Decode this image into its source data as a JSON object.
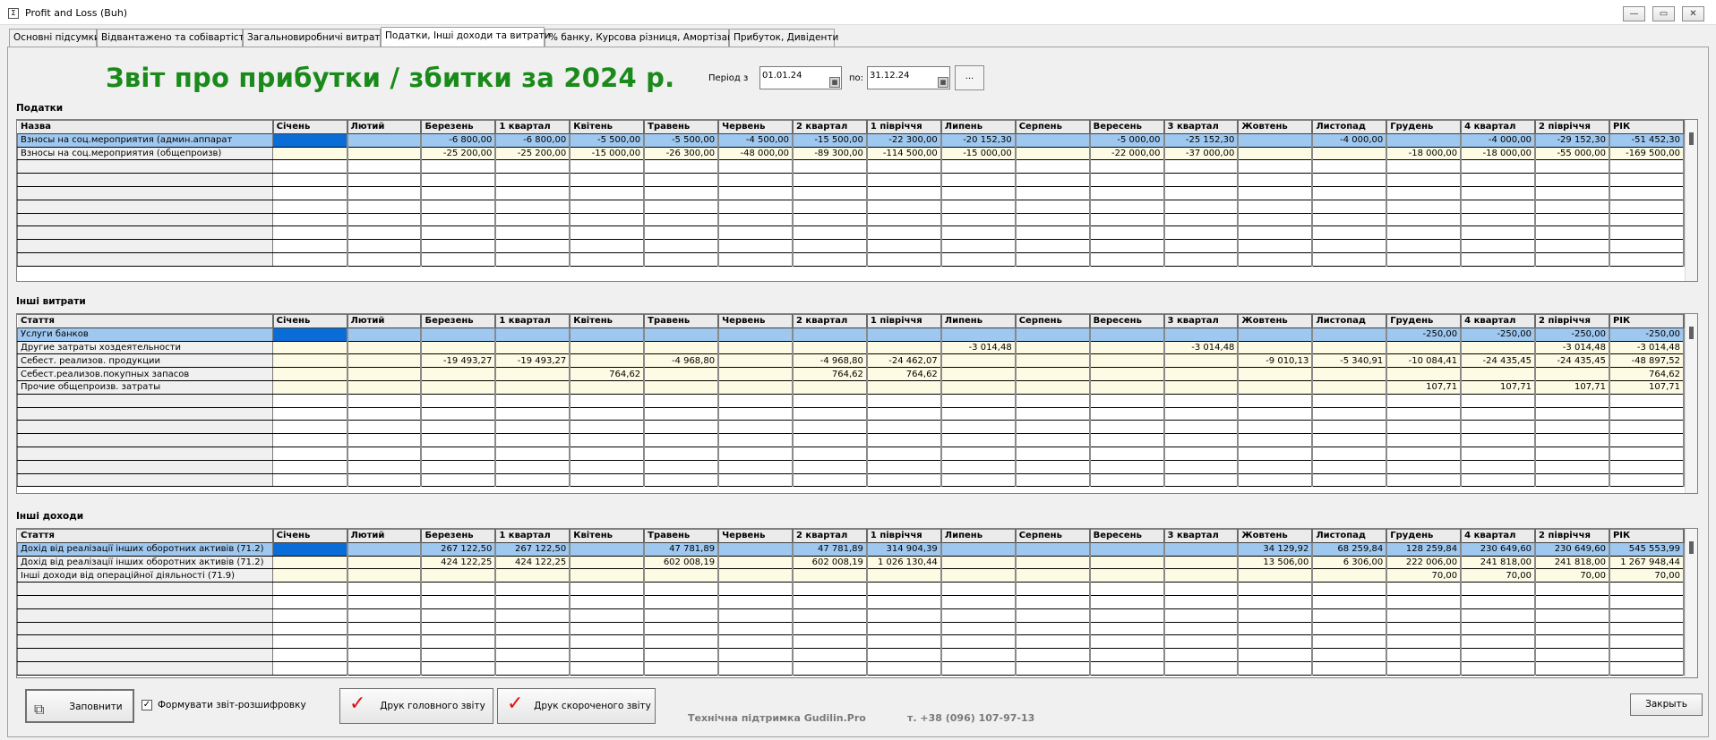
{
  "window": {
    "title": "Profit and Loss (Buh)",
    "app_icon": "calculator-icon",
    "controls": [
      "minimize-icon",
      "maximize-icon",
      "close-icon"
    ]
  },
  "tabs": [
    {
      "label": "Основні підсумки",
      "active": false
    },
    {
      "label": "Відвантажено та собівартість",
      "active": false
    },
    {
      "label": "Загальновиробничі витрати",
      "active": false
    },
    {
      "label": "Податки, Інші доходи та витрати",
      "active": true
    },
    {
      "label": "% банку, Курсова різниця, Амортізація",
      "active": false
    },
    {
      "label": "Прибуток, Дивіденти",
      "active": false
    }
  ],
  "header": {
    "report_title": "Звіт про прибутки / збитки за 2024 р.",
    "period_from_label": "Період з",
    "period_from": "01.01.24",
    "period_to_label": "по:",
    "period_to": "31.12.24",
    "period_button": "..."
  },
  "columns": [
    "Січень",
    "Лютий",
    "Березень",
    "1 квартал",
    "Квітень",
    "Травень",
    "Червень",
    "2 квартал",
    "1 півріччя",
    "Липень",
    "Серпень",
    "Вересень",
    "3 квартал",
    "Жовтень",
    "Листопад",
    "Грудень",
    "4 квартал",
    "2 півріччя",
    "РІК"
  ],
  "taxes": {
    "section_label": "Податки",
    "first_column": "Назва",
    "rows": [
      {
        "name": "Взносы на соц.мероприятия (админ.аппарат",
        "values": [
          "",
          "",
          "-6 800,00",
          "-6 800,00",
          "-5 500,00",
          "-5 500,00",
          "-4 500,00",
          "-15 500,00",
          "-22 300,00",
          "-20 152,30",
          "",
          "-5 000,00",
          "-25 152,30",
          "",
          "-4 000,00",
          "",
          "-4 000,00",
          "-29 152,30",
          "-51 452,30"
        ]
      },
      {
        "name": "Взносы на соц.мероприятия (общепроизв)",
        "values": [
          "",
          "",
          "-25 200,00",
          "-25 200,00",
          "-15 000,00",
          "-26 300,00",
          "-48 000,00",
          "-89 300,00",
          "-114 500,00",
          "-15 000,00",
          "",
          "-22 000,00",
          "-37 000,00",
          "",
          "",
          "-18 000,00",
          "-18 000,00",
          "-55 000,00",
          "-169 500,00"
        ]
      }
    ]
  },
  "other_expenses": {
    "section_label": "Інші витрати",
    "first_column": "Стаття",
    "rows": [
      {
        "name": "Услуги банков",
        "values": [
          "",
          "",
          "",
          "",
          "",
          "",
          "",
          "",
          "",
          "",
          "",
          "",
          "",
          "",
          "",
          "-250,00",
          "-250,00",
          "-250,00",
          "-250,00"
        ]
      },
      {
        "name": "Другие затраты хоздеятельности",
        "values": [
          "",
          "",
          "",
          "",
          "",
          "",
          "",
          "",
          "",
          "-3 014,48",
          "",
          "",
          "-3 014,48",
          "",
          "",
          "",
          "",
          "-3 014,48",
          "-3 014,48"
        ]
      },
      {
        "name": "Себест. реализов. продукции",
        "values": [
          "",
          "",
          "-19 493,27",
          "-19 493,27",
          "",
          "-4 968,80",
          "",
          "-4 968,80",
          "-24 462,07",
          "",
          "",
          "",
          "",
          "-9 010,13",
          "-5 340,91",
          "-10 084,41",
          "-24 435,45",
          "-24 435,45",
          "-48 897,52"
        ]
      },
      {
        "name": "Себест.реализов.покупных запасов",
        "values": [
          "",
          "",
          "",
          "",
          "764,62",
          "",
          "",
          "764,62",
          "764,62",
          "",
          "",
          "",
          "",
          "",
          "",
          "",
          "",
          "",
          "764,62"
        ]
      },
      {
        "name": "Прочие общепроизв. затраты",
        "values": [
          "",
          "",
          "",
          "",
          "",
          "",
          "",
          "",
          "",
          "",
          "",
          "",
          "",
          "",
          "",
          "107,71",
          "107,71",
          "107,71",
          "107,71"
        ]
      }
    ]
  },
  "other_income": {
    "section_label": "Інші доходи",
    "first_column": "Стаття",
    "rows": [
      {
        "name": "Дохід від реалізації інших оборотних активів (71.2)",
        "values": [
          "",
          "",
          "267 122,50",
          "267 122,50",
          "",
          "47 781,89",
          "",
          "47 781,89",
          "314 904,39",
          "",
          "",
          "",
          "",
          "34 129,92",
          "68 259,84",
          "128 259,84",
          "230 649,60",
          "230 649,60",
          "545 553,99"
        ]
      },
      {
        "name": "Дохід від реалізації інших оборотних активів (71.2)",
        "values": [
          "",
          "",
          "424 122,25",
          "424 122,25",
          "",
          "602 008,19",
          "",
          "602 008,19",
          "1 026 130,44",
          "",
          "",
          "",
          "",
          "13 506,00",
          "6 306,00",
          "222 006,00",
          "241 818,00",
          "241 818,00",
          "1 267 948,44"
        ]
      },
      {
        "name": "Інші доходи від операційної діяльності (71.9)",
        "values": [
          "",
          "",
          "",
          "",
          "",
          "",
          "",
          "",
          "",
          "",
          "",
          "",
          "",
          "",
          "",
          "70,00",
          "70,00",
          "70,00",
          "70,00"
        ]
      }
    ]
  },
  "footer": {
    "fill_button": "Заповнити",
    "breakdown_checkbox": "Формувати звіт-розшифровку",
    "breakdown_checked": true,
    "print_main_button": "Друк головного звіту",
    "print_short_button": "Друк скороченого звіту",
    "support_text": "Технічна підтримка Gudilin.Pro",
    "phone_text": "т. +38 (096) 107-97-13",
    "close_button": "Закрыть"
  },
  "colors": {
    "title_green": "#1a8a1a",
    "selected_row": "#9fc8f0",
    "current_cell": "#0a6cd6",
    "data_cell": "#fdfbe3"
  }
}
